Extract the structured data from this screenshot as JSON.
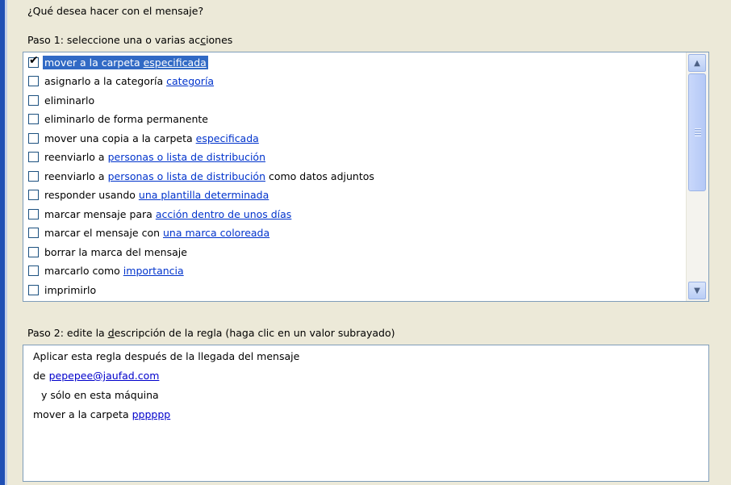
{
  "question": "¿Qué desea hacer con el mensaje?",
  "step1": {
    "prefix": "Paso 1: seleccione una o varias ac",
    "underlined": "c",
    "suffix": "iones"
  },
  "actions": [
    {
      "text": "mover a la carpeta ",
      "link": "especificada",
      "after": "",
      "checked": true
    },
    {
      "text": "asignarlo a la categoría ",
      "link": "categoría",
      "after": "",
      "checked": false
    },
    {
      "text": "eliminarlo",
      "link": "",
      "after": "",
      "checked": false
    },
    {
      "text": "eliminarlo de forma permanente",
      "link": "",
      "after": "",
      "checked": false
    },
    {
      "text": "mover una copia a la carpeta ",
      "link": "especificada",
      "after": "",
      "checked": false
    },
    {
      "text": "reenviarlo a ",
      "link": "personas o lista de distribución",
      "after": "",
      "checked": false
    },
    {
      "text": "reenviarlo a ",
      "link": "personas o lista de distribución",
      "after": " como datos adjuntos",
      "checked": false
    },
    {
      "text": "responder usando ",
      "link": "una plantilla determinada",
      "after": "",
      "checked": false
    },
    {
      "text": "marcar mensaje para ",
      "link": "acción dentro de unos días",
      "after": "",
      "checked": false
    },
    {
      "text": "marcar el mensaje con ",
      "link": "una marca coloreada",
      "after": "",
      "checked": false
    },
    {
      "text": "borrar la marca del mensaje",
      "link": "",
      "after": "",
      "checked": false
    },
    {
      "text": "marcarlo como ",
      "link": "importancia",
      "after": "",
      "checked": false
    },
    {
      "text": "imprimirlo",
      "link": "",
      "after": "",
      "checked": false
    }
  ],
  "step2": {
    "prefix": "Paso 2: edite la ",
    "underlined": "d",
    "suffix": "escripción de la regla (haga clic en un valor subrayado)"
  },
  "description": {
    "line1": "Aplicar esta regla después de la llegada del mensaje",
    "line2_text": "de ",
    "line2_link": "pepepee@jaufad.com",
    "line3": "y sólo en esta máquina",
    "line4_text": "mover a la carpeta ",
    "line4_link": "pppppp"
  },
  "icons": {
    "scroll_up": "scroll-up-arrow-icon",
    "scroll_down": "scroll-down-arrow-icon",
    "check": "check-icon"
  },
  "colors": {
    "selection": "#316ac5",
    "link": "#0033cc",
    "panel": "#ece9d8"
  }
}
